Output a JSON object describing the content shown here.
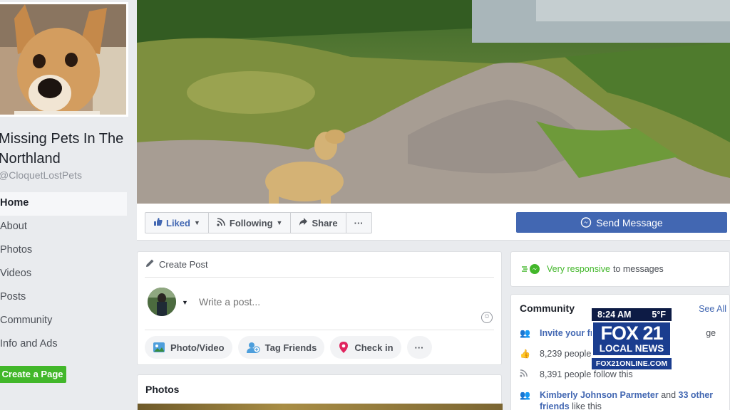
{
  "page": {
    "name": "Missing Pets In The Northland",
    "handle": "@CloquetLostPets"
  },
  "nav": {
    "items": [
      {
        "label": "Home"
      },
      {
        "label": "About"
      },
      {
        "label": "Photos"
      },
      {
        "label": "Videos"
      },
      {
        "label": "Posts"
      },
      {
        "label": "Community"
      },
      {
        "label": "Info and Ads"
      }
    ],
    "create_page": "Create a Page"
  },
  "actions": {
    "liked": "Liked",
    "following": "Following",
    "share": "Share",
    "more": "···",
    "send_message": "Send Message"
  },
  "composer": {
    "title": "Create Post",
    "placeholder": "Write a post...",
    "photo_video": "Photo/Video",
    "tag_friends": "Tag Friends",
    "check_in": "Check in",
    "more": "···"
  },
  "photos": {
    "title": "Photos"
  },
  "responsiveness": {
    "highlight": "Very responsive",
    "rest": "to messages"
  },
  "community": {
    "title": "Community",
    "see_all": "See All",
    "invite_link": "Invite your fr",
    "invite_tail": "ge",
    "likes": "8,239 people",
    "follows": "8,391 people follow this",
    "friends_name": "Kimberly Johnson Parmeter",
    "friends_mid": "and",
    "friends_count": "33 other friends",
    "friends_tail": "like this"
  },
  "overlay": {
    "time": "8:24 AM",
    "temp": "5°F",
    "brand": "FOX 21",
    "sub": "LOCAL NEWS",
    "url": "FOX21ONLINE.COM"
  },
  "colors": {
    "fb_blue": "#4267b2",
    "green": "#42b72a",
    "tv_blue": "#1a3d8f"
  }
}
